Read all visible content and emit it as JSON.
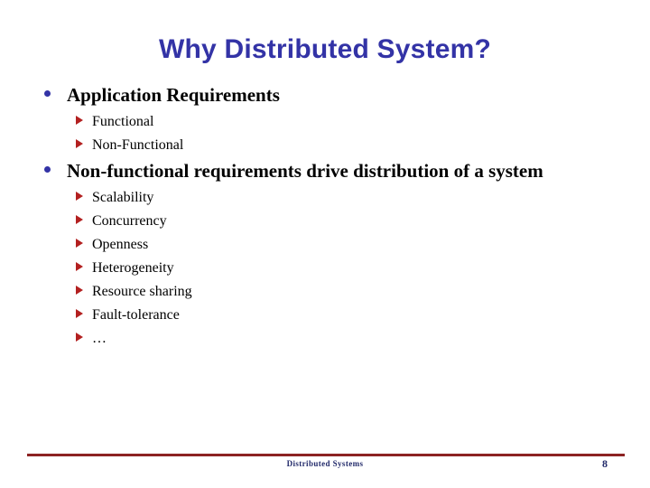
{
  "slide": {
    "title": "Why Distributed System?",
    "title_color": "#3333a6",
    "background_color": "#ffffff",
    "bullet_dot_color": "#3333a6",
    "bullet_triangle_color": "#b32020",
    "body_text_color": "#000000"
  },
  "content": {
    "groups": [
      {
        "heading": "Application Requirements",
        "items": [
          "Functional",
          "Non-Functional"
        ]
      },
      {
        "heading": "Non-functional requirements drive distribution of a system",
        "items": [
          "Scalability",
          "Concurrency",
          "Openness",
          "Heterogeneity",
          "Resource sharing",
          "Fault-tolerance",
          "…"
        ]
      }
    ]
  },
  "footer": {
    "text": "Distributed Systems",
    "page_number": "8",
    "rule_color": "#8d2323",
    "text_color": "#232b6b"
  }
}
